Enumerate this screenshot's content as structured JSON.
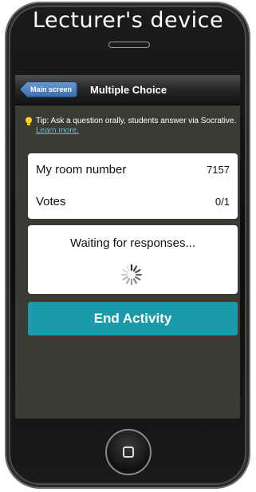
{
  "device": {
    "title": "Lecturer's device"
  },
  "navbar": {
    "back_label": "Main screen",
    "title": "Multiple Choice"
  },
  "tip": {
    "text": "Tip: Ask a question orally, students answer via Socrative.",
    "link": "Learn more.",
    "icon": "lightbulb-icon"
  },
  "stats": {
    "room_label": "My room number",
    "room_value": "7157",
    "votes_label": "Votes",
    "votes_value": "0/1"
  },
  "status": {
    "waiting_text": "Waiting for responses...",
    "icon": "loading-spinner-icon"
  },
  "actions": {
    "end_label": "End Activity"
  },
  "colors": {
    "accent": "#1a9aaa",
    "back_button": "#3c6fb0",
    "screen_bg": "#3b3b34",
    "link": "#6fb2ff"
  }
}
